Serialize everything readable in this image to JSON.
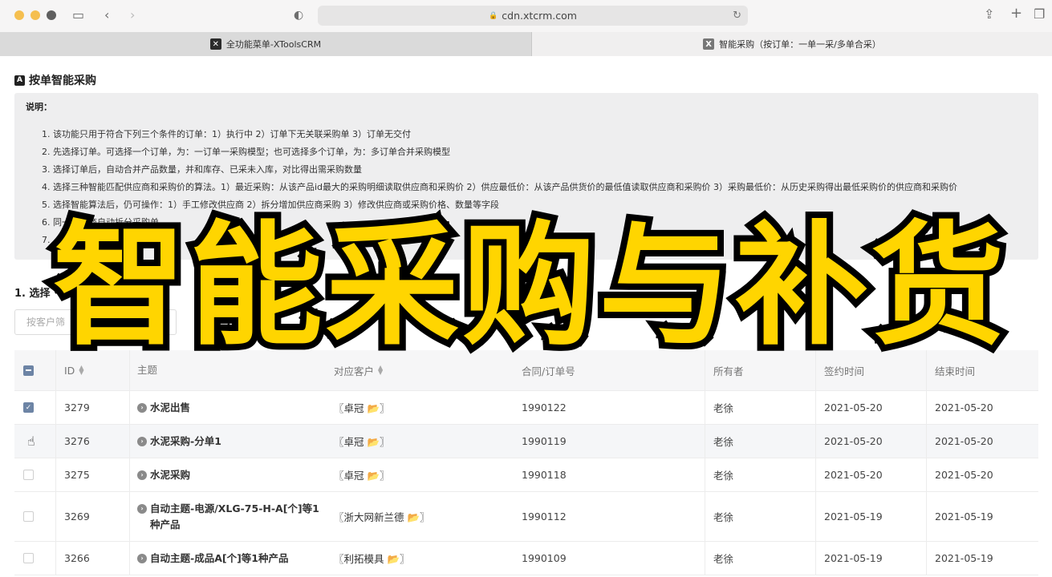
{
  "browser": {
    "url": "cdn.xtcrm.com",
    "tabs": [
      {
        "label": "全功能菜单-XToolsCRM",
        "favicon": "x-logo-icon"
      },
      {
        "label": "智能采购（按订单：一单一采/多单合采）",
        "favicon": "x-logo-icon"
      }
    ]
  },
  "page": {
    "badge": "A",
    "title": "按单智能采购",
    "notice": {
      "heading": "说明：",
      "items": [
        "1. 该功能只用于符合下列三个条件的订单：1）执行中 2）订单下无关联采购单 3）订单无交付",
        "2. 先选择订单。可选择一个订单，为：一订单一采购模型；也可选择多个订单，为：多订单合并采购模型",
        "3. 选择订单后，自动合并产品数量，并和库存、已采未入库，对比得出需采购数量",
        "4. 选择三种智能匹配供应商和采购价的算法。1）最近采购：从该产品id最大的采购明细读取供应商和采购价 2）供应最低价：从该产品供货价的最低值读取供应商和采购价 3）采购最低价：从历史采购得出最低采购价的供应商和采购价",
        "5. 选择智能算法后，仍可操作：1）手工修改供应商 2）拆分增加供应商采购 3）修改供应商或采购价格、数量等字段",
        "6. 同一供应商自动拆分采购单",
        "7."
      ]
    },
    "section_label": "1. 选择",
    "search": {
      "placeholder": "按客户筛",
      "value": ""
    }
  },
  "table": {
    "columns": {
      "id": "ID",
      "subject": "主题",
      "customer": "对应客户",
      "contract": "合同/订单号",
      "owner": "所有者",
      "sign_date": "签约时间",
      "end_date": "结束时间"
    },
    "rows": [
      {
        "checked": true,
        "id": "3279",
        "subject": "水泥出售",
        "customer": "〖卓冠 📂〗",
        "contract": "1990122",
        "owner": "老徐",
        "sign_date": "2021-05-20",
        "end_date": "2021-05-20"
      },
      {
        "checked": false,
        "id": "3276",
        "subject": "水泥采购-分单1",
        "customer": "〖卓冠 📂〗",
        "contract": "1990119",
        "owner": "老徐",
        "sign_date": "2021-05-20",
        "end_date": "2021-05-20"
      },
      {
        "checked": false,
        "id": "3275",
        "subject": "水泥采购",
        "customer": "〖卓冠 📂〗",
        "contract": "1990118",
        "owner": "老徐",
        "sign_date": "2021-05-20",
        "end_date": "2021-05-20"
      },
      {
        "checked": false,
        "id": "3269",
        "subject": "自动主题-电源/XLG-75-H-A[个]等1种产品",
        "customer": "〖浙大网新兰德 📂〗",
        "contract": "1990112",
        "owner": "老徐",
        "sign_date": "2021-05-19",
        "end_date": "2021-05-19"
      },
      {
        "checked": false,
        "id": "3266",
        "subject": "自动主题-成品A[个]等1种产品",
        "customer": "〖利拓模具 📂〗",
        "contract": "1990109",
        "owner": "老徐",
        "sign_date": "2021-05-19",
        "end_date": "2021-05-19"
      }
    ]
  },
  "overlay": {
    "text": "智能采购与补货",
    "color": "#ffd500"
  },
  "colors": {
    "accent": "#6d84a5",
    "notice_bg": "#eeeeef"
  }
}
